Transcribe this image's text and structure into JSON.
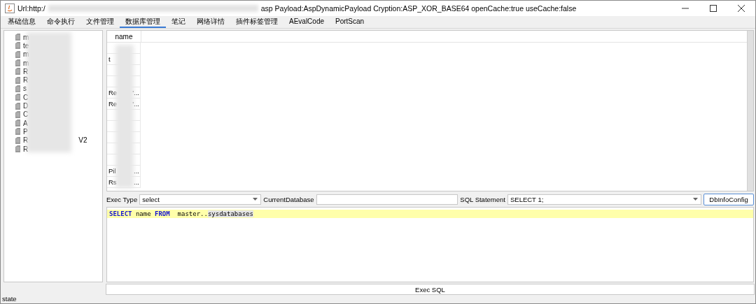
{
  "window": {
    "title_start": "Url:http:/",
    "title_end": "asp Payload:AspDynamicPayload Cryption:ASP_XOR_BASE64 openCache:true useCache:false",
    "redacted": true
  },
  "tabs": [
    {
      "label": "基础信息",
      "selected": false
    },
    {
      "label": "命令执行",
      "selected": false
    },
    {
      "label": "文件管理",
      "selected": false
    },
    {
      "label": "数据库管理",
      "selected": true
    },
    {
      "label": "笔记",
      "selected": false
    },
    {
      "label": "网络详情",
      "selected": false
    },
    {
      "label": "插件标签管理",
      "selected": false
    },
    {
      "label": "AEvalCode",
      "selected": false
    },
    {
      "label": "PortScan",
      "selected": false
    }
  ],
  "tree": {
    "redacted": true,
    "items": [
      {
        "label": "m"
      },
      {
        "label": "te"
      },
      {
        "label": "m"
      },
      {
        "label": "m"
      },
      {
        "label": "R"
      },
      {
        "label": "R"
      },
      {
        "label": "s"
      },
      {
        "label": "C"
      },
      {
        "label": "D"
      },
      {
        "label": "C"
      },
      {
        "label": "A"
      },
      {
        "label": "P"
      },
      {
        "label": "R",
        "tail": "V2"
      },
      {
        "label": "R"
      }
    ]
  },
  "table": {
    "redacted": true,
    "columns": [
      "name"
    ],
    "rows": [
      {
        "head": "",
        "tail": ""
      },
      {
        "head": "t",
        "tail": ""
      },
      {
        "head": "",
        "tail": ""
      },
      {
        "head": "",
        "tail": ""
      },
      {
        "head": "Re",
        "tail": "'..."
      },
      {
        "head": "Re",
        "tail": "'..."
      },
      {
        "head": "",
        "tail": ""
      },
      {
        "head": "",
        "tail": ""
      },
      {
        "head": "",
        "tail": ""
      },
      {
        "head": "",
        "tail": ""
      },
      {
        "head": "",
        "tail": ""
      },
      {
        "head": "Pil",
        "tail": "..."
      },
      {
        "head": "Rs",
        "tail": "..."
      }
    ]
  },
  "toolbar": {
    "exec_type_label": "Exec Type",
    "exec_type_value": "select",
    "current_db_label": "CurrentDatabase",
    "sql_label": "SQL Statement",
    "sql_value": "SELECT 1;",
    "config_button": "DbInfoConfig"
  },
  "editor": {
    "lines": [
      {
        "current": true,
        "tokens": [
          {
            "text": "SELECT",
            "kind": "keyword"
          },
          {
            "text": " name ",
            "kind": "plain"
          },
          {
            "text": "FROM",
            "kind": "keyword"
          },
          {
            "text": "  master..",
            "kind": "plain"
          },
          {
            "text": "sysdatabases",
            "kind": "match"
          }
        ]
      }
    ]
  },
  "exec_button": "Exec SQL",
  "status_bar": "state"
}
